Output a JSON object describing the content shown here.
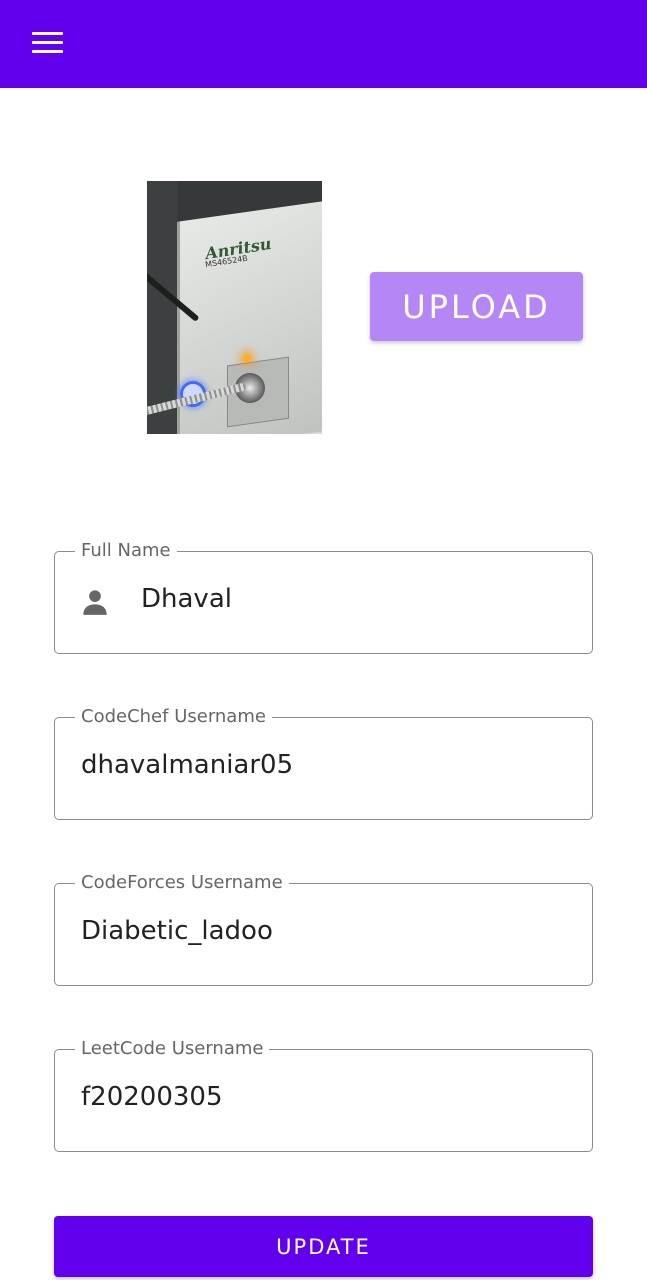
{
  "app_bar": {
    "color": "#6200ee",
    "menu_icon": "hamburger-menu-icon"
  },
  "profile": {
    "photo_description_icon": "profile-photo",
    "upload_label": "UPLOAD"
  },
  "form": {
    "full_name": {
      "label": "Full Name",
      "value": "Dhaval",
      "icon": "person-icon"
    },
    "codechef": {
      "label": "CodeChef Username",
      "value": "dhavalmaniar05"
    },
    "codeforces": {
      "label": "CodeForces Username",
      "value": "Diabetic_ladoo"
    },
    "leetcode": {
      "label": "LeetCode Username",
      "value": "f20200305"
    }
  },
  "actions": {
    "update_label": "UPDATE"
  },
  "colors": {
    "primary": "#6200ee",
    "upload_button": "#b586f6",
    "field_border": "#8c8c8c"
  }
}
